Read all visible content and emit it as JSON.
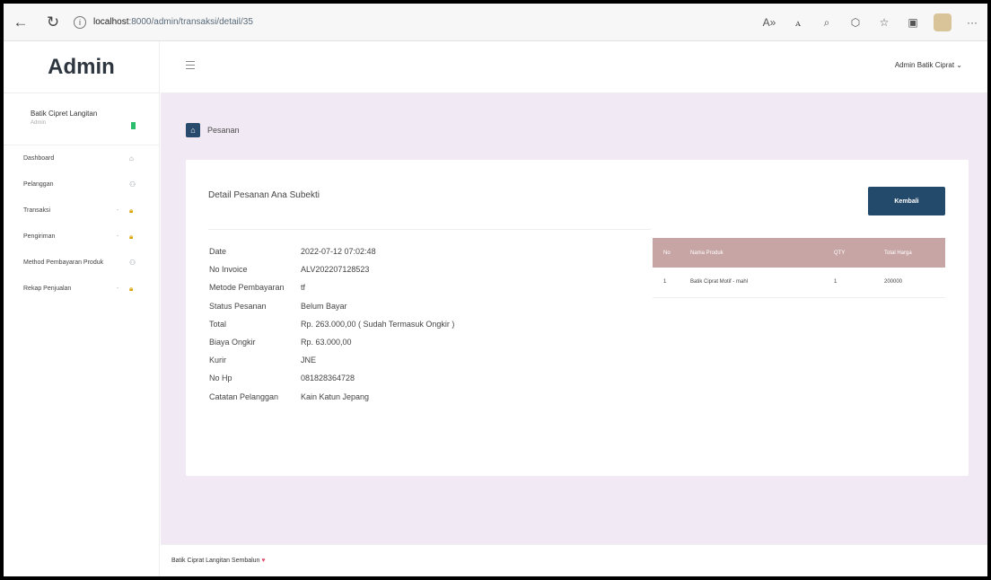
{
  "browser": {
    "url_host": "localhost",
    "url_path": ":8000/admin/transaksi/detail/35",
    "back_icon": "arrow-left-icon",
    "refresh_icon": "refresh-icon",
    "toolbar_icons": [
      "read-aloud-icon",
      "text-size-icon",
      "zoom-icon",
      "extensions-icon",
      "favorites-icon",
      "collections-icon",
      "profile-icon",
      "more-icon"
    ]
  },
  "sidebar": {
    "brand": "Admin",
    "user_name": "Batik Cipret Langitan",
    "user_role": "Admin",
    "items": [
      {
        "label": "Dashboard",
        "icon": "home-icon",
        "locked": false
      },
      {
        "label": "Pelanggan",
        "icon": "users-icon",
        "locked": false
      },
      {
        "label": "Transaksi",
        "icon": "lock-icon",
        "locked": true
      },
      {
        "label": "Pengiriman",
        "icon": "lock-icon",
        "locked": true
      },
      {
        "label": "Method Pembayaran Produk",
        "icon": "users-icon",
        "locked": false
      },
      {
        "label": "Rekap Penjualan",
        "icon": "lock-icon",
        "locked": true
      }
    ]
  },
  "topbar": {
    "user_menu": "Admin Batik Ciprat ⌄"
  },
  "page": {
    "title": "Pesanan",
    "card_title": "Detail Pesanan Ana Subekti",
    "back_button": "Kembali"
  },
  "details": [
    {
      "label": "Date",
      "value": "2022-07-12 07:02:48"
    },
    {
      "label": "No Invoice",
      "value": "ALV202207128523"
    },
    {
      "label": "Metode Pembayaran",
      "value": "tf"
    },
    {
      "label": "Status Pesanan",
      "value": "Belum Bayar"
    },
    {
      "label": "Total",
      "value": "Rp. 263.000,00 ( Sudah Termasuk Ongkir )"
    },
    {
      "label": "Biaya Ongkir",
      "value": "Rp. 63.000,00"
    },
    {
      "label": "Kurir",
      "value": "JNE"
    },
    {
      "label": "No Hp",
      "value": "081828364728"
    },
    {
      "label": "Catatan Pelanggan",
      "value": "Kain Katun Jepang"
    }
  ],
  "products_table": {
    "headers": [
      "No",
      "Nama Produk",
      "QTY",
      "Total Harga"
    ],
    "rows": [
      [
        "1",
        "Batik Ciprat Motif - mahl",
        "1",
        "200000"
      ]
    ]
  },
  "footer": {
    "text": "Batik Ciprat Langitan Sembalun",
    "heart": "♥"
  },
  "colors": {
    "primary": "#244a6b",
    "table_header": "#c7a5a5",
    "content_bg": "#f1e9f4"
  }
}
